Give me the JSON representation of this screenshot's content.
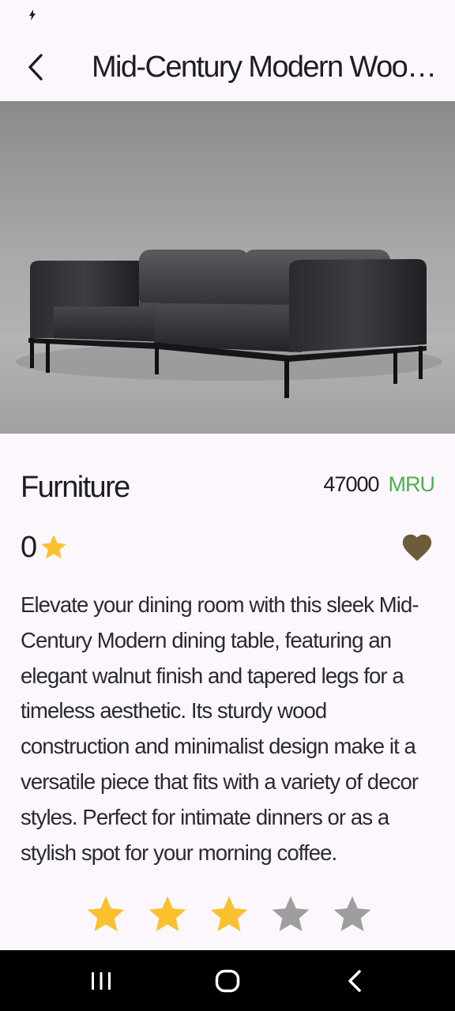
{
  "app_bar": {
    "title": "Mid-Century Modern Woode...",
    "back_icon": "chevron-left-icon"
  },
  "product": {
    "category": "Furniture",
    "price": "47000",
    "currency": "MRU",
    "rating": "0",
    "description": "Elevate your dining room with this sleek Mid-Century Modern dining table, featuring an elegant walnut finish and tapered legs for a timeless aesthetic. Its sturdy wood construction and minimalist design make it a versatile piece that fits with a variety of decor styles. Perfect for intimate dinners or as a stylish spot for your morning coffee."
  },
  "rating_input": {
    "stars_filled": 3,
    "stars_total": 5
  },
  "colors": {
    "background": "#fcf7fc",
    "star_gold": "#fbc02d",
    "star_gray": "#9e9e9e",
    "heart": "#6d5c3c",
    "currency_green": "#4caf50",
    "nav_bar": "#000000"
  }
}
